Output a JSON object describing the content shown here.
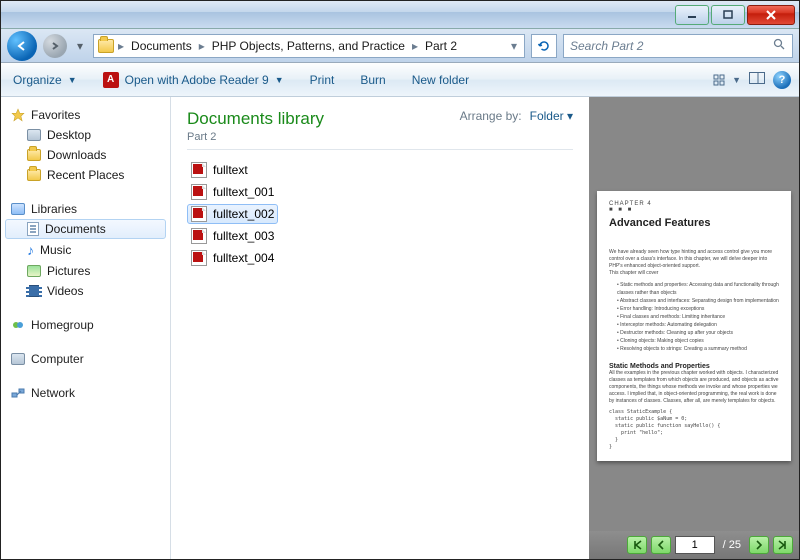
{
  "breadcrumb": {
    "c1": "Documents",
    "c2": "PHP Objects, Patterns, and Practice",
    "c3": "Part 2"
  },
  "search": {
    "placeholder": "Search Part 2"
  },
  "toolbar": {
    "organize": "Organize",
    "openwith": "Open with Adobe Reader 9",
    "print": "Print",
    "burn": "Burn",
    "newfolder": "New folder"
  },
  "nav": {
    "favorites": "Favorites",
    "desktop": "Desktop",
    "downloads": "Downloads",
    "recent": "Recent Places",
    "libraries": "Libraries",
    "documents": "Documents",
    "music": "Music",
    "pictures": "Pictures",
    "videos": "Videos",
    "homegroup": "Homegroup",
    "computer": "Computer",
    "network": "Network"
  },
  "library": {
    "title": "Documents library",
    "subtitle": "Part 2",
    "arrange_label": "Arrange by:",
    "arrange_value": "Folder"
  },
  "files": {
    "f0": "fulltext",
    "f1": "fulltext_001",
    "f2": "fulltext_002",
    "f3": "fulltext_003",
    "f4": "fulltext_004"
  },
  "preview": {
    "chapter_label": "CHAPTER 4",
    "chapter_title": "Advanced Features",
    "section": "Static Methods and Properties",
    "current_page": "1",
    "total_pages": "/ 25"
  }
}
